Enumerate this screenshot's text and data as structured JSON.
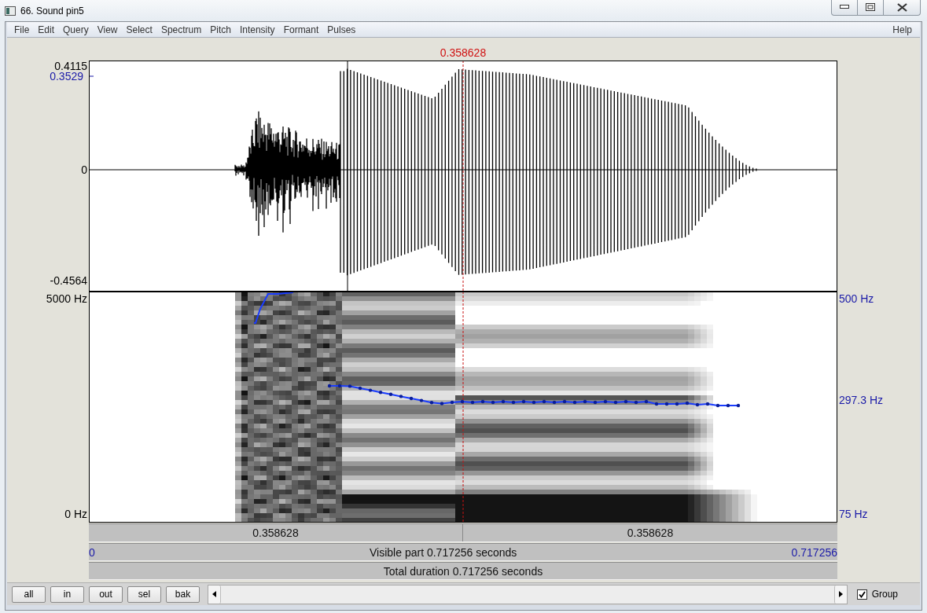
{
  "window": {
    "title": "66. Sound pin5"
  },
  "menu": [
    "File",
    "Edit",
    "Query",
    "View",
    "Select",
    "Spectrum",
    "Pitch",
    "Intensity",
    "Formant",
    "Pulses"
  ],
  "help_menu": "Help",
  "cursor_time": "0.358628",
  "waveform": {
    "y_max": "0.4115",
    "y_mark": "0.3529",
    "y_zero": "0",
    "y_min": "-0.4564"
  },
  "spectrogram": {
    "f_max": "5000 Hz",
    "f_min": "0 Hz",
    "pitch_max": "500 Hz",
    "pitch_value": "297.3 Hz",
    "pitch_min": "75 Hz"
  },
  "time_bars": {
    "left_part": "0.358628",
    "right_part": "0.358628",
    "visible_start": "0",
    "visible_label": "Visible part 0.717256 seconds",
    "visible_end": "0.717256",
    "total": "Total duration 0.717256 seconds"
  },
  "buttons": [
    "all",
    "in",
    "out",
    "sel",
    "bak"
  ],
  "group": {
    "label": "Group",
    "checked": true
  }
}
